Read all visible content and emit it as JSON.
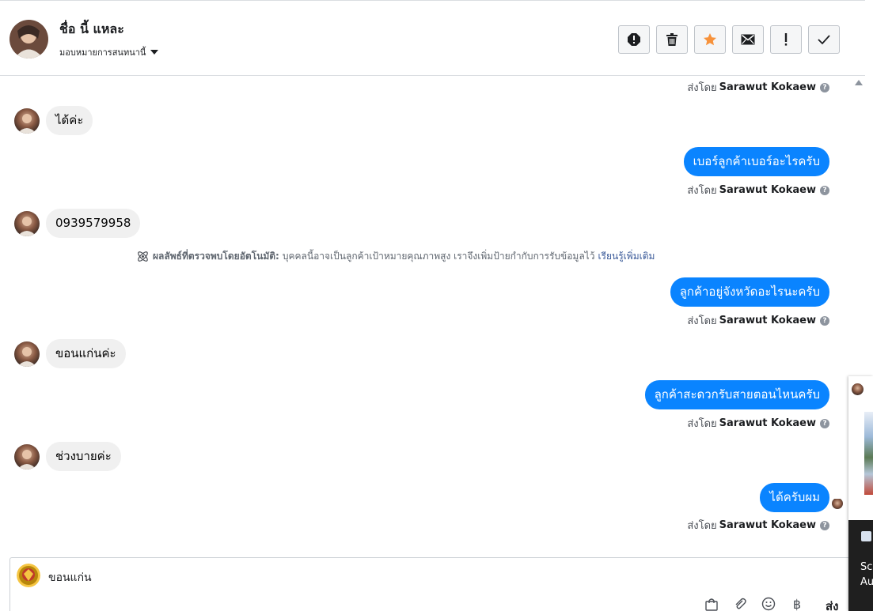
{
  "header": {
    "contact_name": "ชื่อ นี้ แหละ",
    "assign_label": "มอบหมายการสนทนานี้",
    "actions": [
      {
        "name": "spam-button",
        "icon": "alert-circle-icon"
      },
      {
        "name": "delete-button",
        "icon": "trash-icon"
      },
      {
        "name": "star-button",
        "icon": "star-icon"
      },
      {
        "name": "mark-unread-button",
        "icon": "envelope-icon"
      },
      {
        "name": "follow-up-button",
        "icon": "exclamation-icon"
      },
      {
        "name": "mark-done-button",
        "icon": "check-icon"
      }
    ]
  },
  "messages": {
    "sent_by_label": "ส่งโดย",
    "sender": "Sarawut Kokaew",
    "m1": "ได้ค่ะ",
    "m2": "เบอร์ลูกค้าเบอร์อะไรครับ",
    "m3": "0939579958",
    "auto_note": {
      "title": "ผลลัพธ์ที่ตรวจพบโดยอัตโนมัติ:",
      "body": "บุคคลนี้อาจเป็นลูกค้าเป้าหมายคุณภาพสูง เราจึงเพิ่มป้ายกำกับการรับข้อมูลไว้",
      "link": "เรียนรู้เพิ่มเติม"
    },
    "m4": "ลูกค้าอยู่จังหวัดอะไรนะครับ",
    "m5": "ขอนแก่นค่ะ",
    "m6": "ลูกค้าสะดวกรับสายตอนไหนครับ",
    "m7": "ช่วงบายค่ะ",
    "m8": "ได้ครับผม"
  },
  "composer": {
    "text": "ขอนแก่น",
    "baht_symbol": "฿",
    "send_label": "ส่ง"
  },
  "side_panel": {
    "line1": "Sc",
    "line2": "Au"
  },
  "colors": {
    "outgoing_bubble": "#0a84ff",
    "incoming_bubble": "#f0f0f0",
    "star": "#f7923b"
  }
}
